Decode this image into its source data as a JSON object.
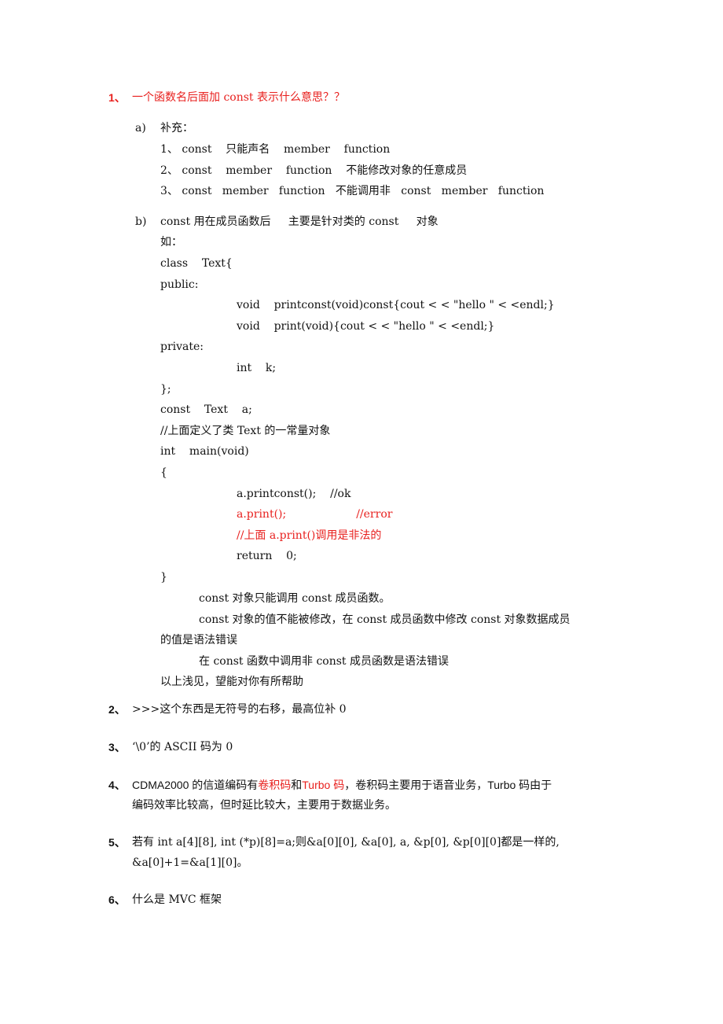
{
  "q1": {
    "number": "1、",
    "title": "一个函数名后面加 const 表示什么意思？？",
    "a_marker": "a)",
    "a_label": "补充：",
    "a_items": [
      "1、 const    只能声名    member    function",
      "2、 const    member    function    不能修改对象的任意成员",
      "3、 const   member   function   不能调用非   const   member   function"
    ],
    "b_marker": "b)",
    "b_title": "const 用在成员函数后     主要是针对类的 const     对象",
    "b_example": "如：",
    "code": [
      {
        "text": "class    Text{",
        "indent": 0,
        "red": false
      },
      {
        "text": "public:",
        "indent": 0,
        "red": false
      },
      {
        "text": "void    printconst(void)const{cout < < \"hello \" < <endl;}",
        "indent": 1,
        "red": false
      },
      {
        "text": "void    print(void){cout < < \"hello \" < <endl;}",
        "indent": 1,
        "red": false
      },
      {
        "text": "private:",
        "indent": 0,
        "red": false
      },
      {
        "text": "int    k;",
        "indent": 1,
        "red": false
      },
      {
        "text": "};",
        "indent": 0,
        "red": false
      },
      {
        "text": "const    Text    a;",
        "indent": 0,
        "red": false
      },
      {
        "text": "//上面定义了类 Text 的一常量对象",
        "indent": 0,
        "red": false
      },
      {
        "text": "int    main(void)",
        "indent": 0,
        "red": false
      },
      {
        "text": "{",
        "indent": 0,
        "red": false
      },
      {
        "text": "a.printconst();    //ok",
        "indent": 1,
        "red": false
      },
      {
        "text": "a.print();                    //error",
        "indent": 1,
        "red": true
      },
      {
        "text": "//上面 a.print()调用是非法的",
        "indent": 1,
        "red": true
      },
      {
        "text": "return    0;",
        "indent": 1,
        "red": false
      },
      {
        "text": "}",
        "indent": 0,
        "red": false
      }
    ],
    "notes": [
      "const 对象只能调用 const 成员函数。",
      "const 对象的值不能被修改，在 const 成员函数中修改 const 对象数据成员",
      "的值是语法错误",
      "在 const 函数中调用非 const 成员函数是语法错误",
      "以上浅见，望能对你有所帮助"
    ]
  },
  "q2": {
    "number": "2、",
    "text": ">>>这个东西是无符号的右移，最高位补 0"
  },
  "q3": {
    "number": "3、",
    "text": "‘\\0’的 ASCII 码为 0"
  },
  "q4": {
    "number": "4、",
    "part1": "CDMA2000 的信道编码有",
    "red1": "卷积码",
    "part2": "和",
    "red2": "Turbo 码",
    "part3": "，卷积码主要用于语音业务，Turbo 码由于",
    "line2": "编码效率比较高，但时延比较大，主要用于数据业务。"
  },
  "q5": {
    "number": "5、",
    "line1": "若有 int a[4][8], int (*p)[8]=a;则&a[0][0], &a[0], a, &p[0], &p[0][0]都是一样的,",
    "line2": "&a[0]+1=&a[1][0]。"
  },
  "q6": {
    "number": "6、",
    "text": "什么是 MVC 框架"
  },
  "colors": {
    "highlight": "#e8201e",
    "text": "#111111"
  }
}
